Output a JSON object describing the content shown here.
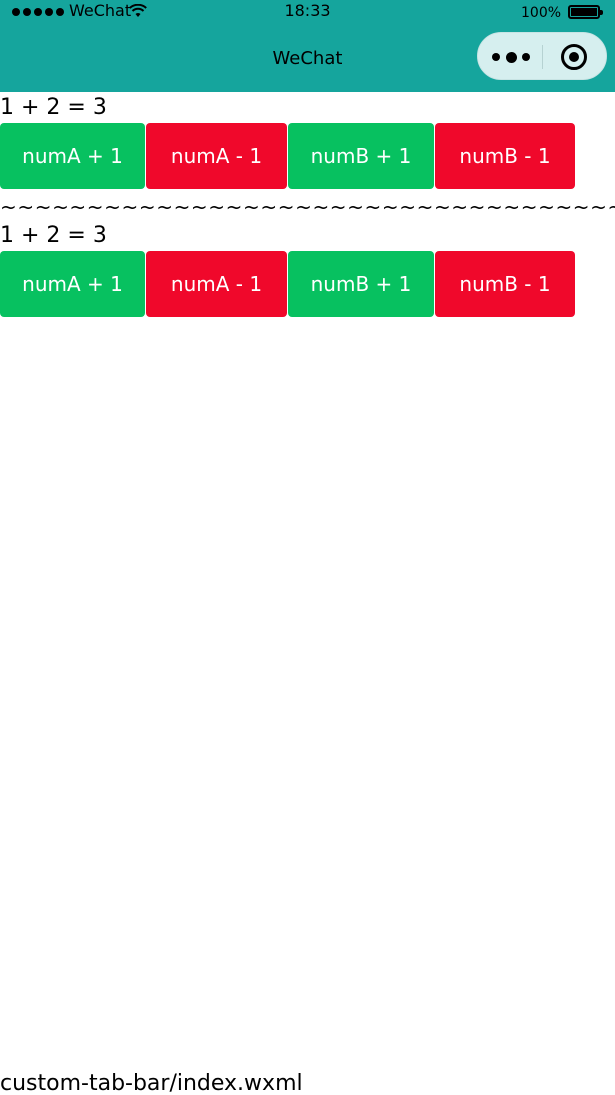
{
  "status_bar": {
    "carrier": "WeChat",
    "time": "18:33",
    "battery_text": "100%",
    "icons": [
      "signal-dots-icon",
      "wifi-icon",
      "battery-icon"
    ]
  },
  "nav_bar": {
    "title": "WeChat",
    "background_color": "#15a59d",
    "capsule_icons": [
      "more-icon",
      "close-icon"
    ]
  },
  "main": {
    "section_1": {
      "equation": "1 + 2 = 3",
      "buttons": [
        {
          "label": "numA + 1",
          "color": "#07c160"
        },
        {
          "label": "numA - 1",
          "color": "#f0082b"
        },
        {
          "label": "numB + 1",
          "color": "#07c160"
        },
        {
          "label": "numB - 1",
          "color": "#f0082b"
        }
      ]
    },
    "separator": "~~~~~~~~~~~~~~~~~~~~~~~~~~~~~~~~~~~~~~~~~~~~",
    "section_2": {
      "equation": "1 + 2 = 3",
      "buttons": [
        {
          "label": "numA + 1",
          "color": "#07c160"
        },
        {
          "label": "numA - 1",
          "color": "#f0082b"
        },
        {
          "label": "numB + 1",
          "color": "#07c160"
        },
        {
          "label": "numB - 1",
          "color": "#f0082b"
        }
      ]
    }
  },
  "footer": {
    "path": "custom-tab-bar/index.wxml"
  }
}
